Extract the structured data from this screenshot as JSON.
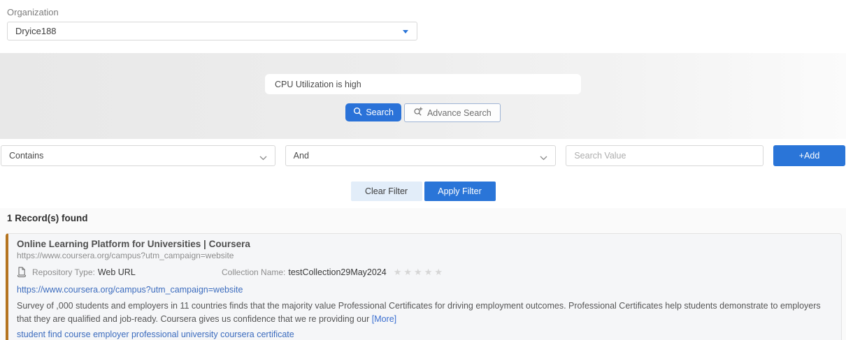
{
  "organization": {
    "label": "Organization",
    "value": "Dryice188"
  },
  "search": {
    "query": "CPU Utilization is high",
    "search_button": "Search",
    "advance_search_button": "Advance Search"
  },
  "filter": {
    "operator": "Contains",
    "conjunction": "And",
    "value_placeholder": "Search Value",
    "add_button": "+Add",
    "clear_button": "Clear Filter",
    "apply_button": "Apply Filter"
  },
  "results": {
    "count_text": "1 Record(s) found",
    "records": [
      {
        "title": "Online Learning Platform for Universities | Coursera",
        "subtitle_url": "https://www.coursera.org/campus?utm_campaign=website",
        "repository_type_label": "Repository Type:",
        "repository_type": "Web URL",
        "collection_name_label": "Collection Name:",
        "collection_name": "testCollection29May2024",
        "rating": 0,
        "rating_max": 5,
        "link": "https://www.coursera.org/campus?utm_campaign=website",
        "description": "Survey of ,000 students and employers in 11 countries finds that the majority value Professional Certificates for driving employment outcomes. Professional Certificates help students demonstrate to employers that they are qualified and job-ready. Coursera gives us confidence that we re providing our",
        "more_label": "[More]",
        "tags": "student find course employer professional university coursera certificate"
      }
    ]
  },
  "colors": {
    "accent_blue": "#2a75d8",
    "link_blue": "#3c6cbe",
    "card_accent": "#b5741f",
    "star_gray": "#d6d6d6"
  }
}
